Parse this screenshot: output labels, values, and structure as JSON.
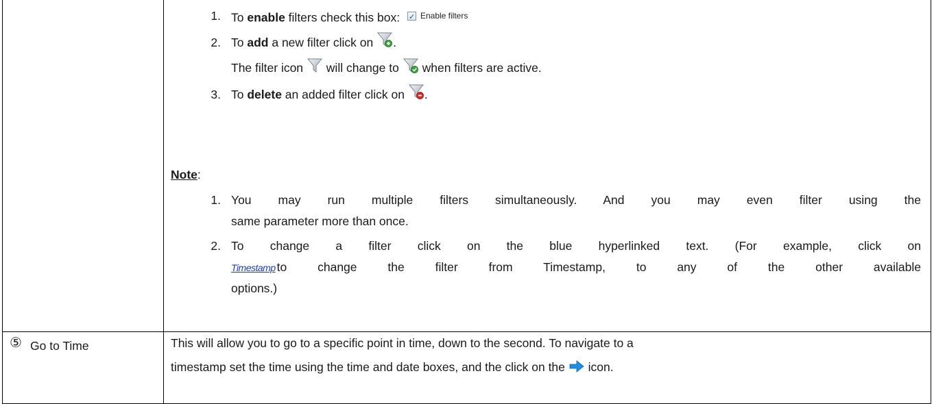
{
  "filters": {
    "steps": [
      {
        "num": "1.",
        "pre": "To ",
        "bold": "enable",
        "post": " filters check this box:",
        "checkbox_label": "Enable filters"
      },
      {
        "num": "2.",
        "pre": "To ",
        "bold": "add",
        "post": " a new filter click on",
        "end": "."
      },
      {
        "num": "3.",
        "pre": "To ",
        "bold": "delete",
        "post": " an added filter click on",
        "end": "."
      }
    ],
    "active_note": {
      "pre": "The filter icon",
      "mid": "will change to",
      "post": "when filters are active."
    }
  },
  "note": {
    "heading": "Note",
    "colon": ":",
    "items": [
      {
        "num": "1.",
        "line1": "You may run multiple filters simultaneously. And you may even filter using the",
        "line2": "same parameter more than once."
      },
      {
        "num": "2.",
        "line1": "To change a filter click on the blue hyperlinked text. (For example, click on",
        "link_text": "Timestamp",
        "line2": "to change the filter from Timestamp, to any of the other available",
        "line3": "options.)"
      }
    ]
  },
  "go_to_time": {
    "marker": "⑤",
    "label": "Go to Time",
    "line1": "This will allow you to go to a specific point in time, down to the second. To navigate to a",
    "line2_pre": "timestamp set the time using the time and date boxes, and the click on the",
    "line2_post": "icon."
  },
  "icons": {
    "filter_add": "filter-add-icon",
    "filter_plain": "filter-icon",
    "filter_active": "filter-active-icon",
    "filter_delete": "filter-delete-icon",
    "arrow": "arrow-right-icon",
    "checkbox": "checked-checkbox-icon"
  }
}
